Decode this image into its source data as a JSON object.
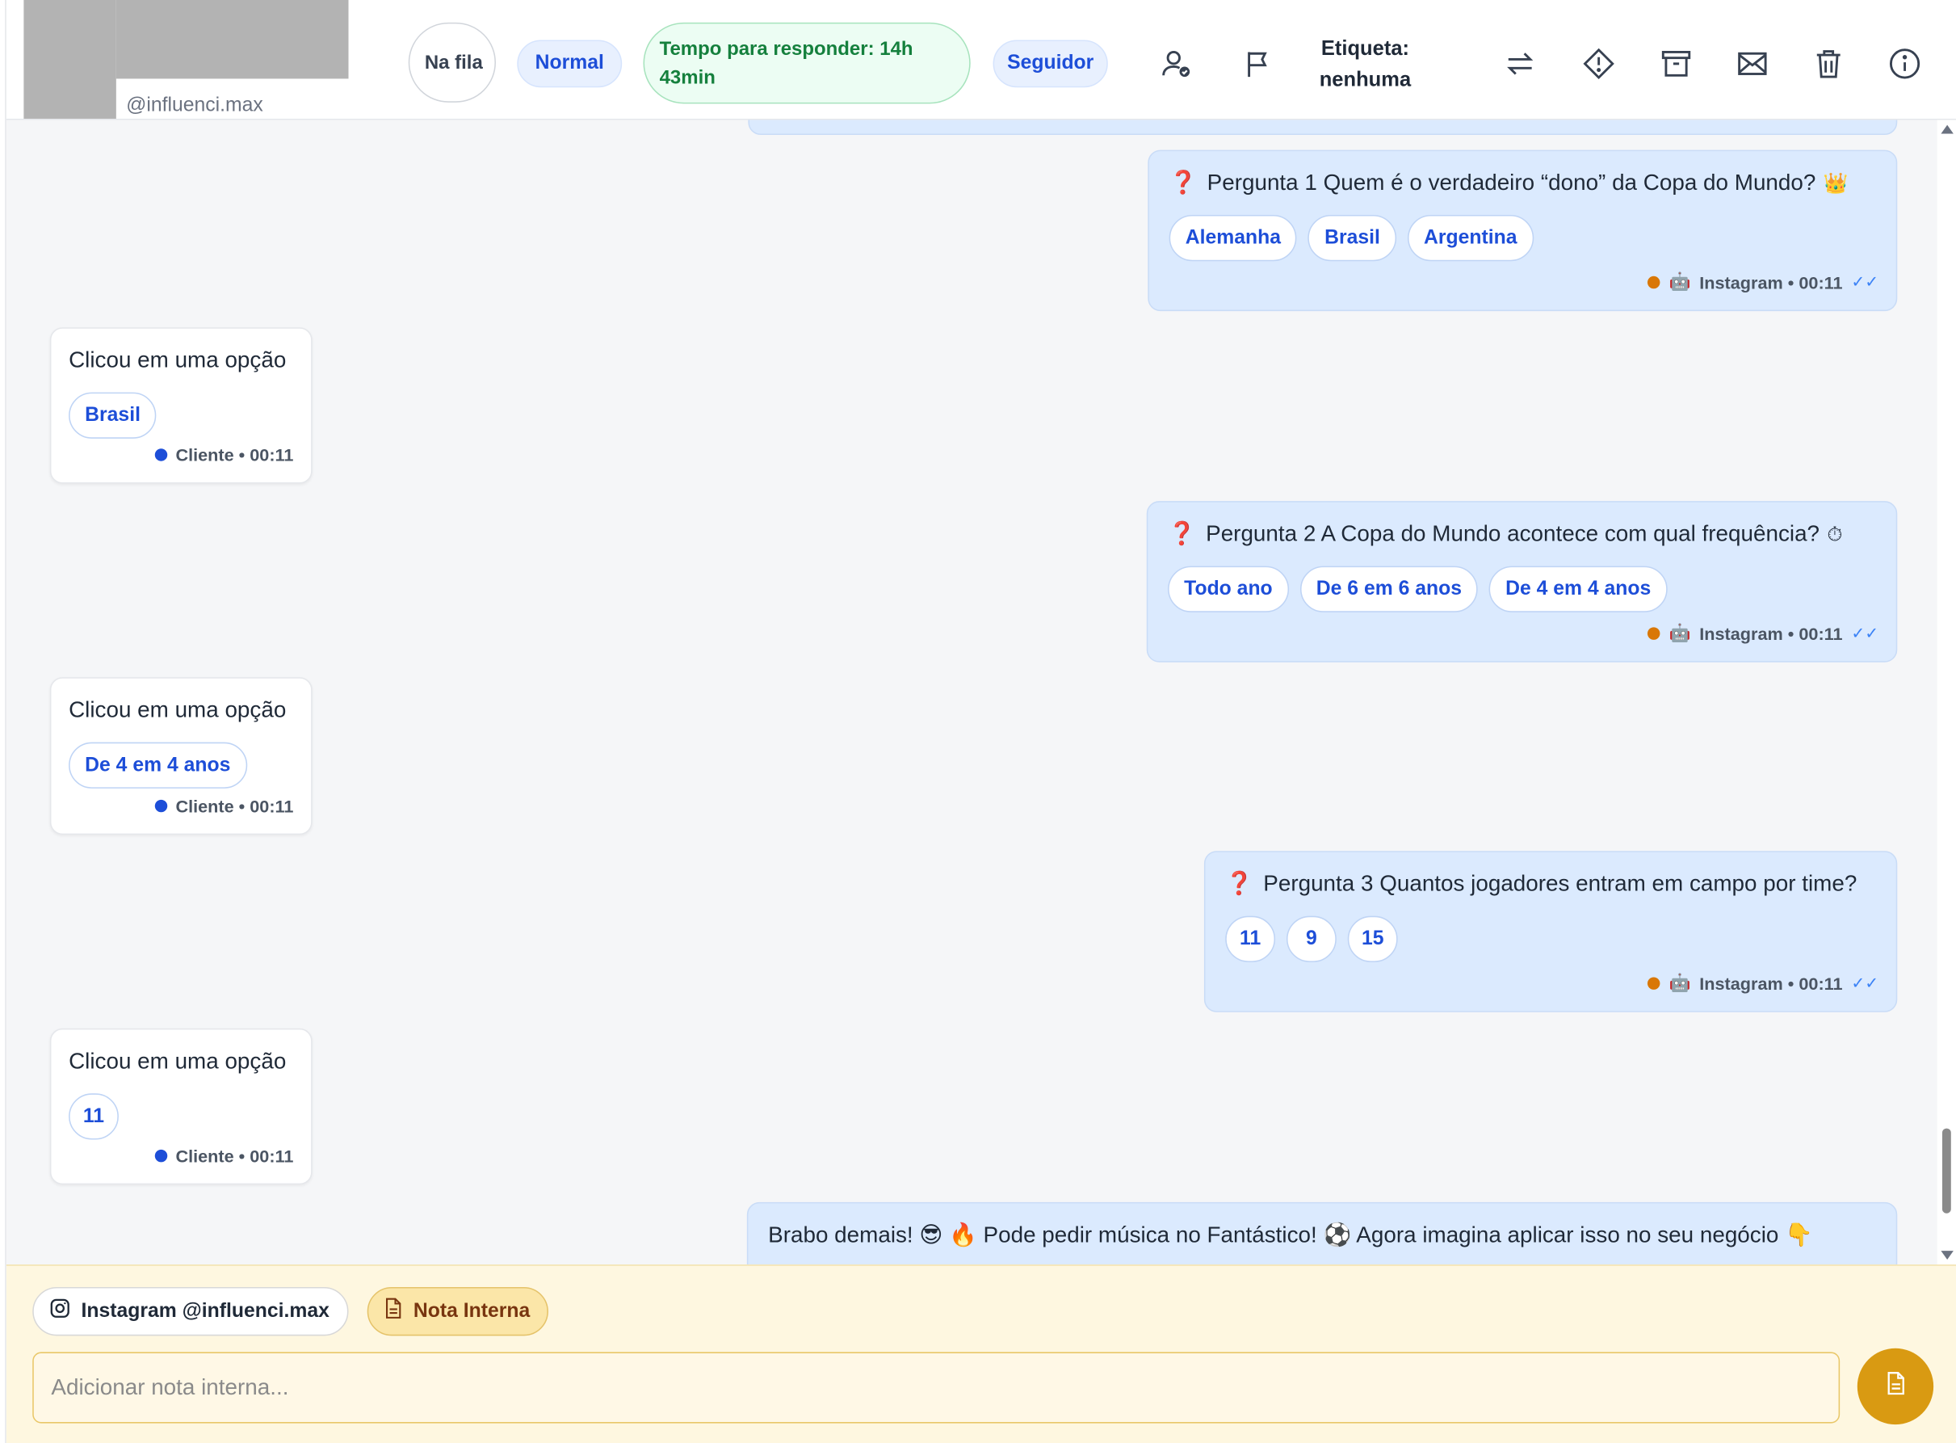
{
  "header": {
    "handle": "@influenci.max",
    "status_queue": "Na fila",
    "priority": "Normal",
    "response_time": "Tempo para responder: 14h 43min",
    "follower": "Seguidor",
    "label": "Etiqueta: nenhuma",
    "icons": [
      "user-check-icon",
      "flag-icon",
      "transfer-icon",
      "warning-icon",
      "archive-icon",
      "mail-icon",
      "trash-icon",
      "info-icon"
    ]
  },
  "messages": [
    {
      "kind": "question",
      "text": "Pergunta 1 Quem é o verdadeiro “dono” da Copa do Mundo?",
      "emoji": "👑",
      "options": [
        "Alemanha",
        "Brasil",
        "Argentina"
      ],
      "meta": "Instagram • 00:11"
    },
    {
      "kind": "answer",
      "text": "Clicou em uma opção",
      "option": "Brasil",
      "meta": "Cliente • 00:11"
    },
    {
      "kind": "question",
      "text": "Pergunta 2 A Copa do Mundo acontece com qual frequência?",
      "emoji": "⏱",
      "options": [
        "Todo ano",
        "De 6 em 6 anos",
        "De 4 em 4 anos"
      ],
      "meta": "Instagram • 00:11"
    },
    {
      "kind": "answer",
      "text": "Clicou em uma opção",
      "option": "De 4 em 4 anos",
      "meta": "Cliente • 00:11"
    },
    {
      "kind": "question",
      "text": "Pergunta 3 Quantos jogadores entram em campo por time?",
      "emoji": "",
      "options": [
        "11",
        "9",
        "15"
      ],
      "meta": "Instagram • 00:11"
    },
    {
      "kind": "answer",
      "text": "Clicou em uma opção",
      "option": "11",
      "meta": "Cliente • 00:11"
    },
    {
      "kind": "text",
      "text": "Brabo demais! 😎 🔥 Pode pedir música no Fantástico! ⚽ Agora imagina aplicar isso no seu negócio 👇"
    }
  ],
  "composer": {
    "channel": "Instagram @influenci.max",
    "note_tab": "Nota Interna",
    "placeholder": "Adicionar nota interna..."
  },
  "colors": {
    "accent": "#1d4ed8",
    "outgoing_bubble": "#dbeafe",
    "composer_bg": "#fef7e0",
    "send_button": "#d99a12",
    "time_pill": "#15803d"
  }
}
